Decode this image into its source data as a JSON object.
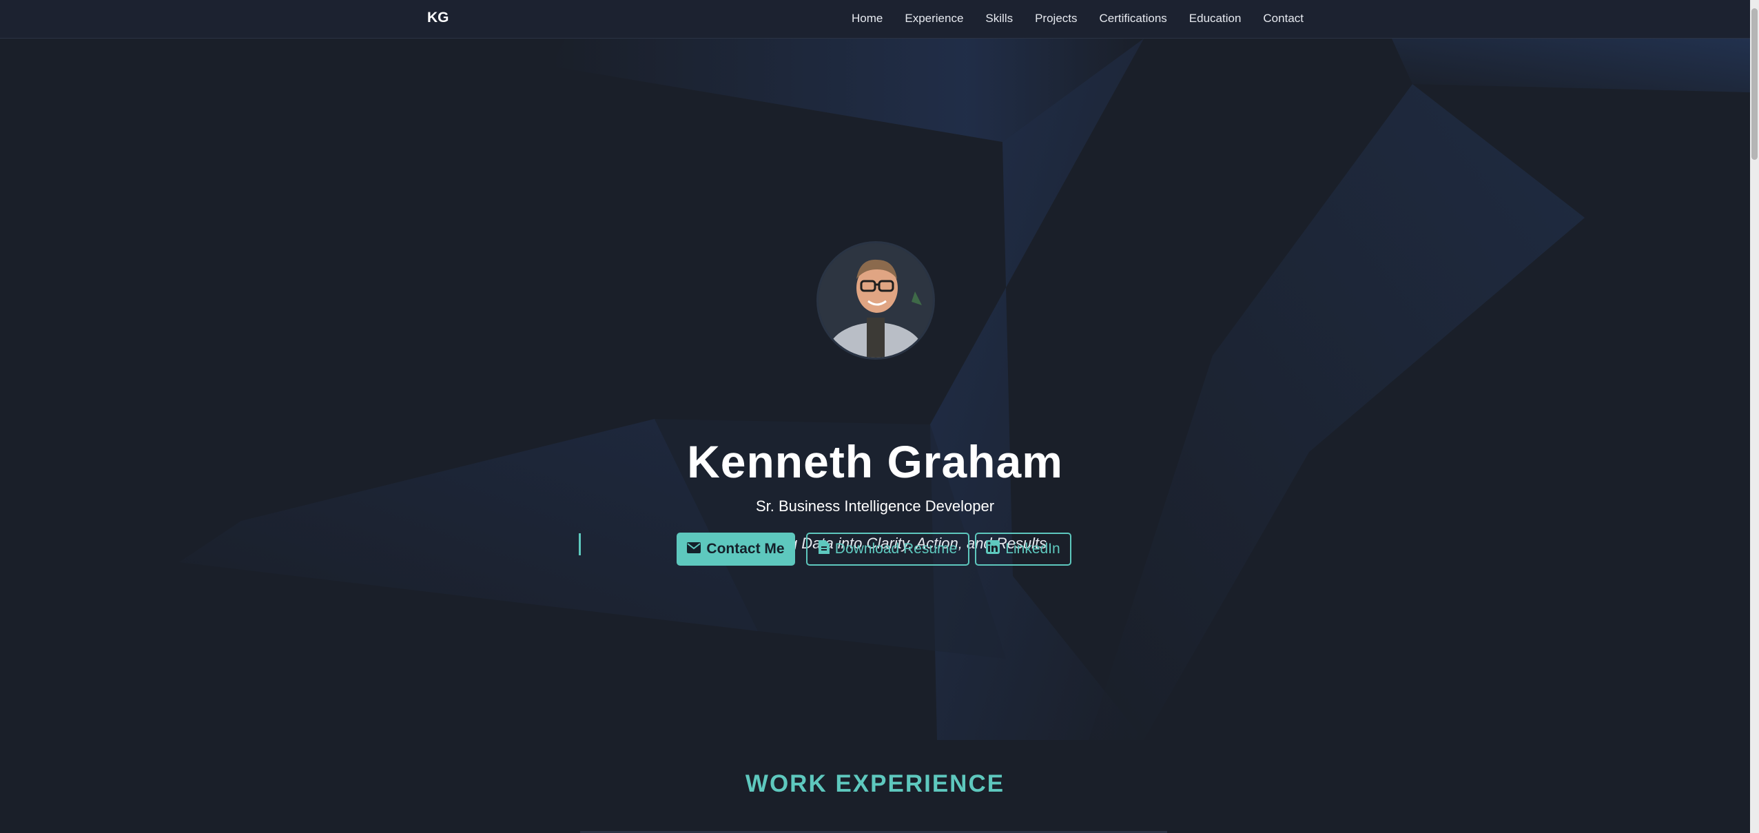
{
  "nav": {
    "brand": "KG",
    "links": [
      "Home",
      "Experience",
      "Skills",
      "Projects",
      "Certifications",
      "Education",
      "Contact"
    ]
  },
  "hero": {
    "name": "Kenneth Graham",
    "title": "Sr. Business Intelligence Developer",
    "tagline": "Translating Data into Clarity, Action, and Results",
    "buttons": {
      "contact": "Contact Me",
      "resume": "Download Resume",
      "linkedin": "LinkedIn"
    }
  },
  "sections": {
    "experience_title": "WORK EXPERIENCE"
  },
  "colors": {
    "accent": "#5ec8be",
    "background": "#1a1f29",
    "navbar": "#1c2230"
  },
  "icons": {
    "contact": "envelope-icon",
    "resume": "file-icon",
    "linkedin": "linkedin-icon"
  }
}
